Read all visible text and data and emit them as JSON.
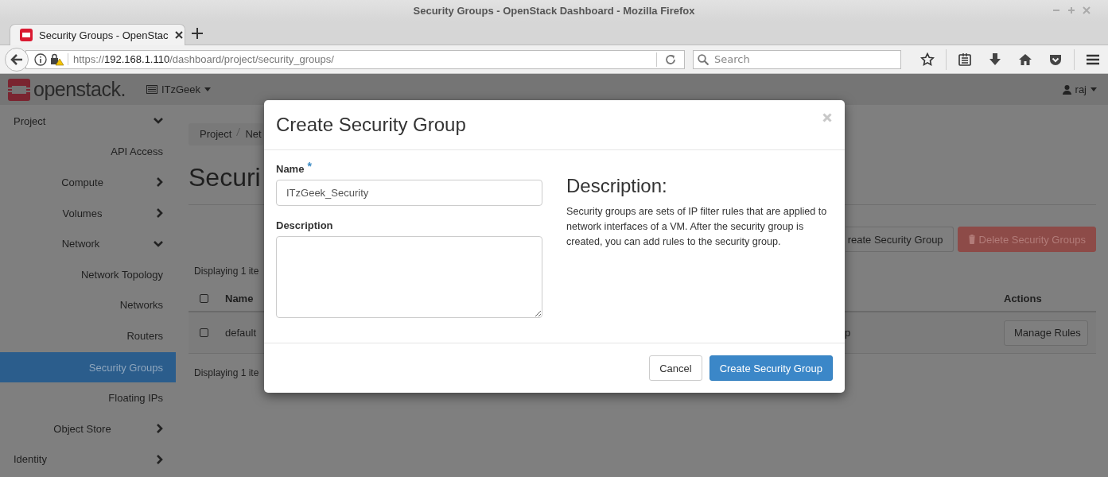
{
  "browser": {
    "title": "Security Groups - OpenStack Dashboard - Mozilla Firefox",
    "tab": {
      "title": "Security Groups - OpenStac"
    },
    "url": {
      "scheme": "https://",
      "host": "192.168.1.110",
      "path": "/dashboard/project/security_groups/"
    },
    "search": {
      "placeholder": "Search"
    }
  },
  "header": {
    "brand": "openstack.",
    "project": "ITzGeek",
    "user": "raj"
  },
  "sidebar": {
    "items": [
      {
        "label": "Project",
        "kind": "group",
        "expanded": true,
        "children": [
          {
            "label": "API Access",
            "kind": "panel",
            "selected": false
          },
          {
            "label": "Compute",
            "kind": "group",
            "expanded": false
          },
          {
            "label": "Volumes",
            "kind": "group",
            "expanded": false
          },
          {
            "label": "Network",
            "kind": "group",
            "expanded": true,
            "children": [
              {
                "label": "Network Topology",
                "kind": "panel",
                "selected": false
              },
              {
                "label": "Networks",
                "kind": "panel",
                "selected": false
              },
              {
                "label": "Routers",
                "kind": "panel",
                "selected": false
              },
              {
                "label": "Security Groups",
                "kind": "panel",
                "selected": true
              },
              {
                "label": "Floating IPs",
                "kind": "panel",
                "selected": false
              }
            ]
          },
          {
            "label": "Object Store",
            "kind": "group",
            "expanded": false
          }
        ]
      },
      {
        "label": "Identity",
        "kind": "group",
        "expanded": false
      }
    ]
  },
  "content": {
    "breadcrumb": [
      "Project",
      "Net"
    ],
    "title": "Securi",
    "actions": [
      {
        "label": "reate Security Group",
        "kind": "default",
        "disabled": false
      },
      {
        "label": "Delete Security Groups",
        "kind": "danger",
        "disabled": true
      }
    ],
    "summary_top": "Displaying 1 ite",
    "table": {
      "select_all": {
        "checked": false
      },
      "columns": [
        {
          "label": "Name"
        },
        {
          "label": "Actions"
        }
      ],
      "rows": [
        {
          "checked": false,
          "name": "default",
          "column_3": "p",
          "action": "Manage Rules"
        }
      ]
    },
    "summary_bottom": "Displaying 1 ite"
  },
  "modal": {
    "title": "Create Security Group",
    "fields": [
      {
        "kind": "text",
        "label": "Name",
        "required_mark": "*",
        "value": "ITzGeek_Security"
      },
      {
        "kind": "textarea",
        "label": "Description"
      }
    ],
    "help": {
      "heading": "Description:",
      "text": "Security groups are sets of IP filter rules that are applied to network interfaces of a VM. After the security group is created, you can add rules to the security group."
    },
    "buttons": [
      {
        "label": "Cancel",
        "kind": "default"
      },
      {
        "label": "Create Security Group",
        "kind": "primary"
      }
    ]
  }
}
